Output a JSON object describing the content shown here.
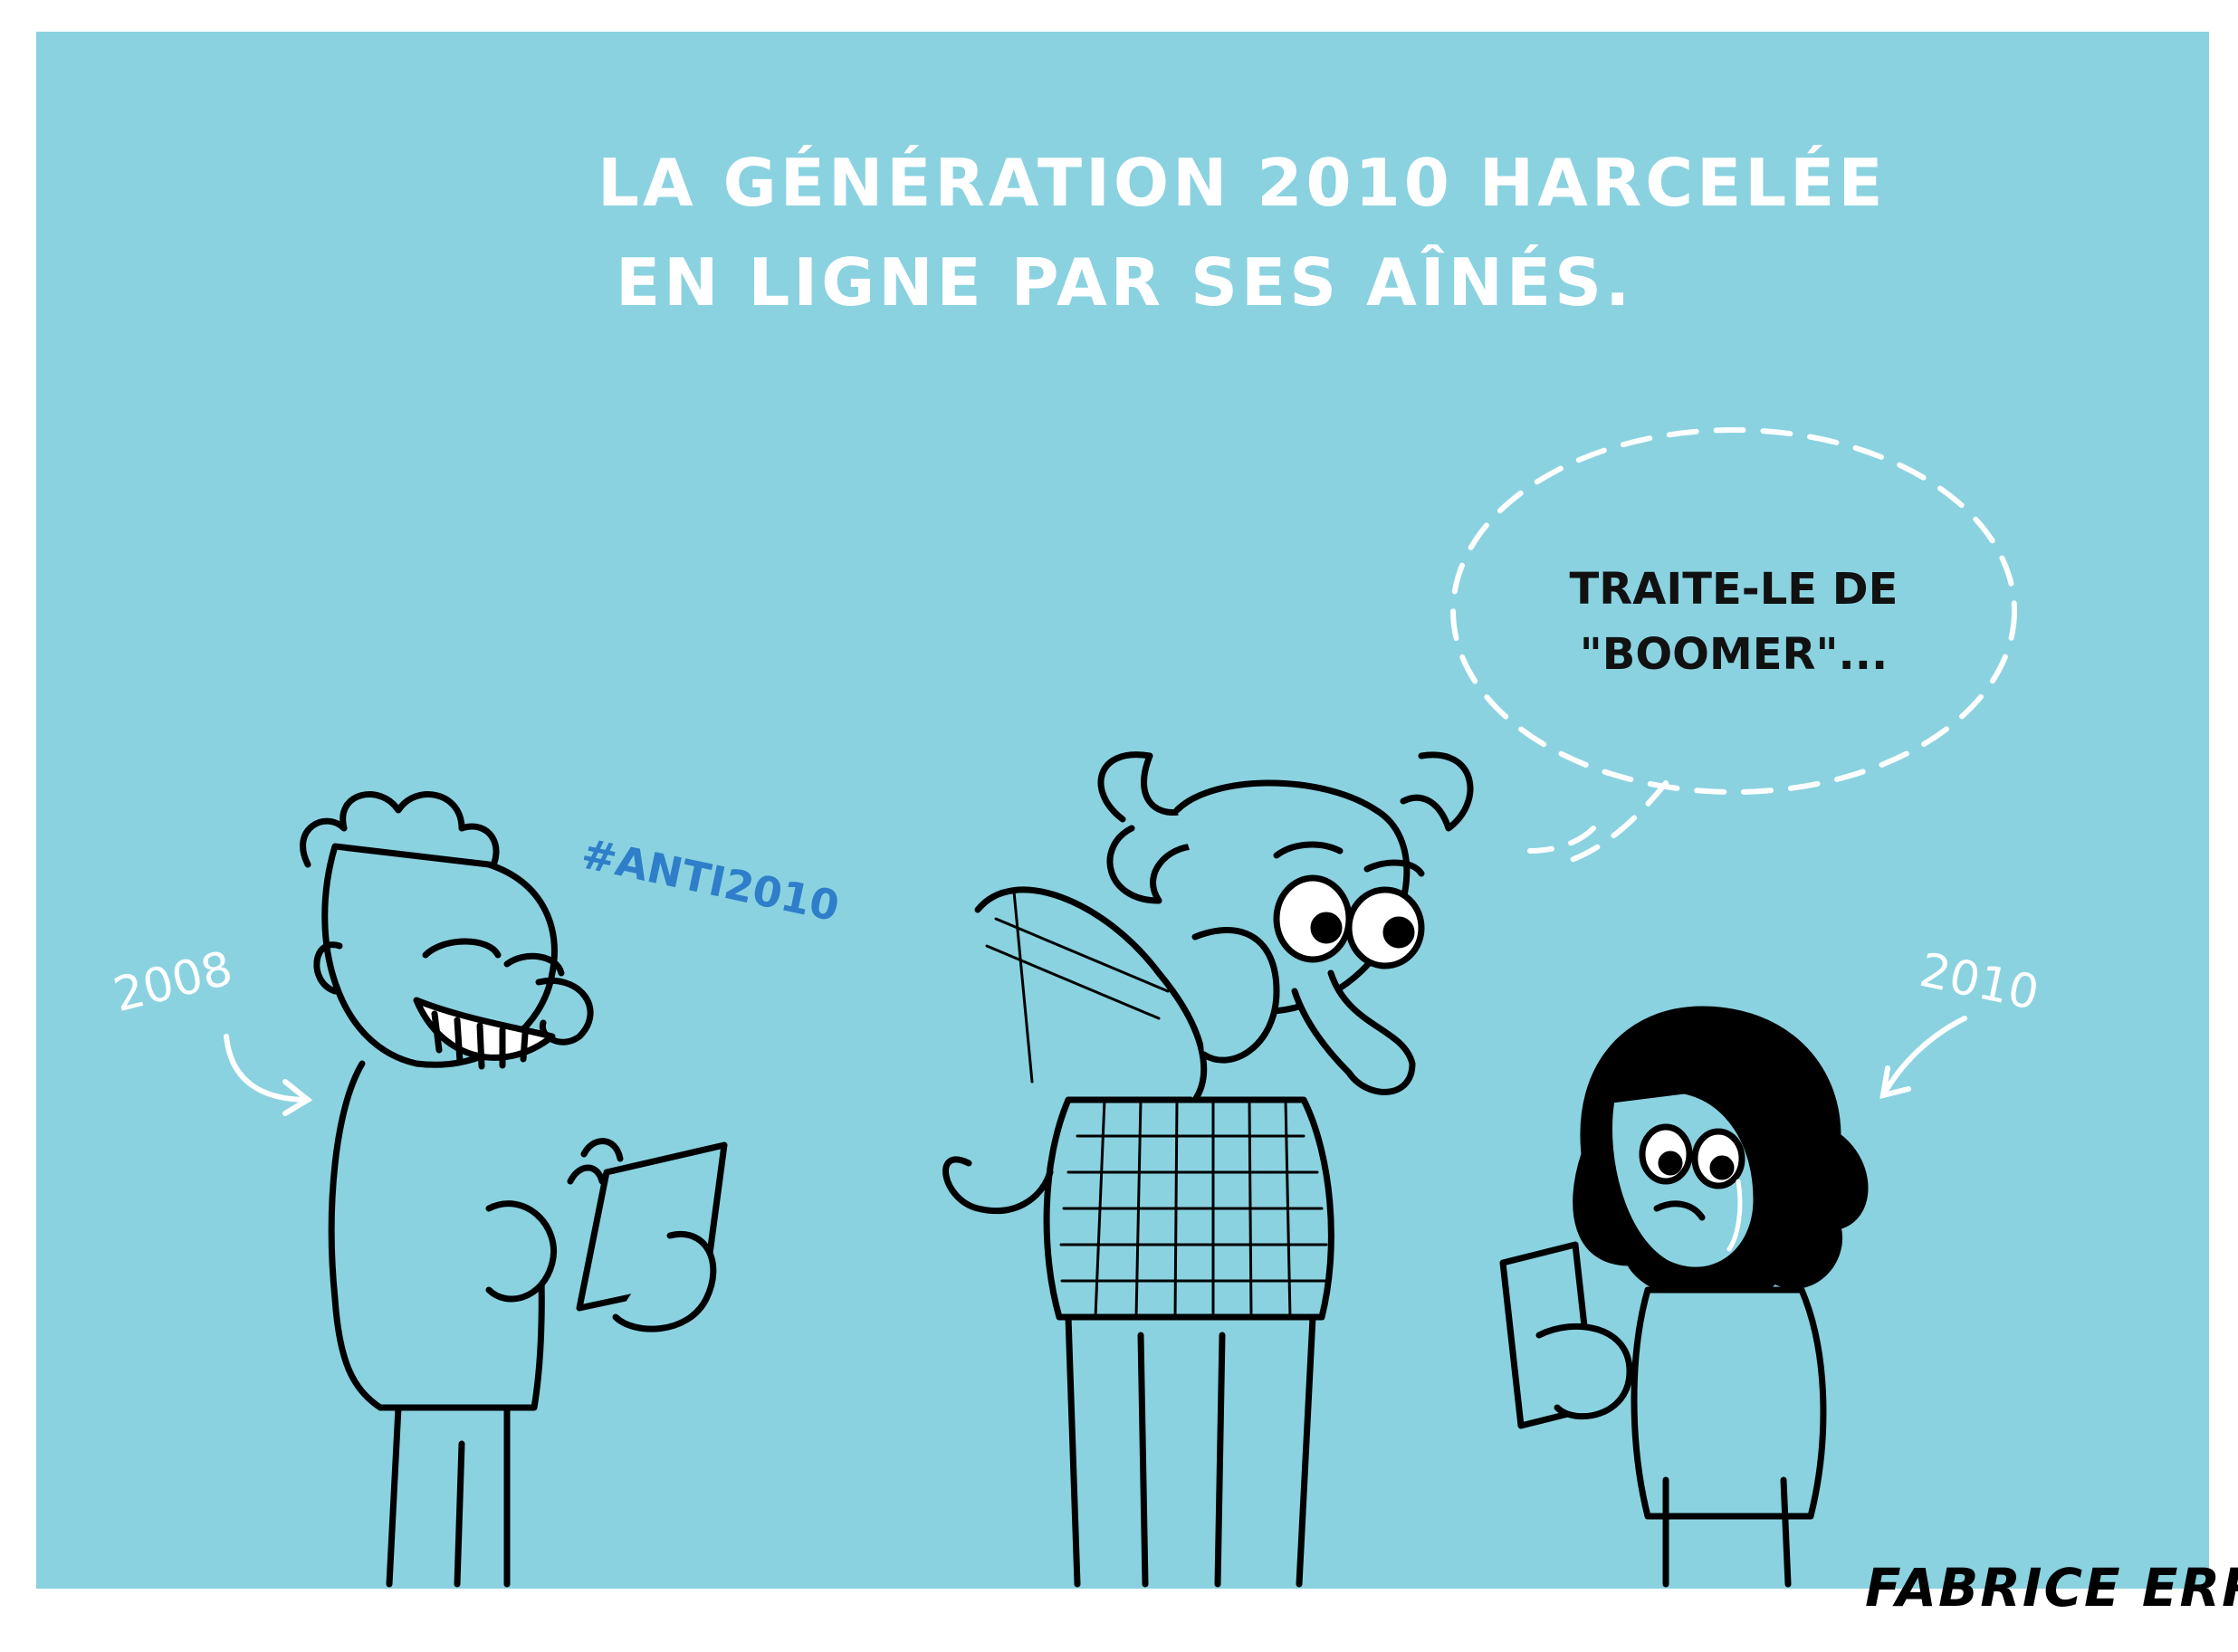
{
  "title": {
    "line1": "LA GÉNÉRATION 2010 HARCELÉE",
    "line2": "EN LIGNE PAR SES AÎNÉS."
  },
  "labels": {
    "left_year": "2008",
    "right_year": "2010",
    "hashtag": "#ANTI2010"
  },
  "speech_bubble": {
    "line1": "TRAITE-LE DE",
    "line2": "\"BOOMER\"..."
  },
  "signature": "FABRICE ERRE",
  "colors": {
    "background": "#8ad2e0",
    "ink": "#000000",
    "hashtag": "#2f7ec9"
  }
}
